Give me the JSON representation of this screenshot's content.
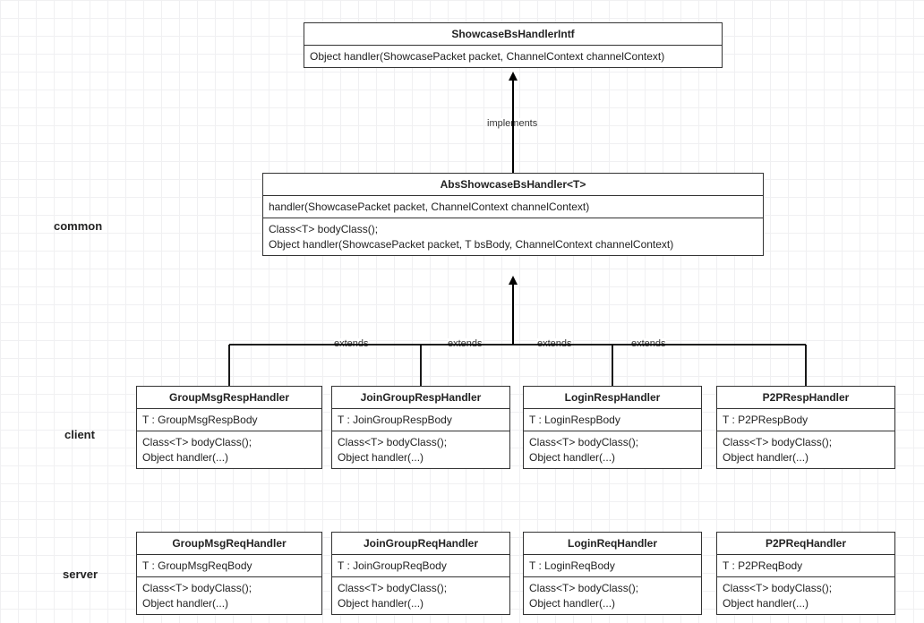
{
  "labels": {
    "common": "common",
    "client": "client",
    "server": "server",
    "implements": "implements",
    "extends": "extends"
  },
  "interface": {
    "name": "ShowcaseBsHandlerIntf",
    "method": "Object handler(ShowcasePacket packet, ChannelContext channelContext)"
  },
  "abs": {
    "name": "AbsShowcaseBsHandler<T>",
    "impl": "handler(ShowcasePacket packet, ChannelContext channelContext)",
    "abs1": "Class<T> bodyClass();",
    "abs2": "Object handler(ShowcasePacket packet, T bsBody, ChannelContext channelContext)"
  },
  "client_classes": [
    {
      "name": "GroupMsgRespHandler",
      "t": "T : GroupMsgRespBody",
      "m1": "Class<T> bodyClass();",
      "m2": "Object handler(...)"
    },
    {
      "name": "JoinGroupRespHandler",
      "t": "T : JoinGroupRespBody",
      "m1": "Class<T> bodyClass();",
      "m2": "Object handler(...)"
    },
    {
      "name": "LoginRespHandler",
      "t": "T : LoginRespBody",
      "m1": "Class<T> bodyClass();",
      "m2": "Object handler(...)"
    },
    {
      "name": "P2PRespHandler",
      "t": "T : P2PRespBody",
      "m1": "Class<T> bodyClass();",
      "m2": "Object handler(...)"
    }
  ],
  "server_classes": [
    {
      "name": "GroupMsgReqHandler",
      "t": "T : GroupMsgReqBody",
      "m1": "Class<T> bodyClass();",
      "m2": "Object handler(...)"
    },
    {
      "name": "JoinGroupReqHandler",
      "t": "T : JoinGroupReqBody",
      "m1": "Class<T> bodyClass();",
      "m2": "Object handler(...)"
    },
    {
      "name": "LoginReqHandler",
      "t": "T : LoginReqBody",
      "m1": "Class<T> bodyClass();",
      "m2": "Object handler(...)"
    },
    {
      "name": "P2PReqHandler",
      "t": "T : P2PReqBody",
      "m1": "Class<T> bodyClass();",
      "m2": "Object handler(...)"
    }
  ]
}
